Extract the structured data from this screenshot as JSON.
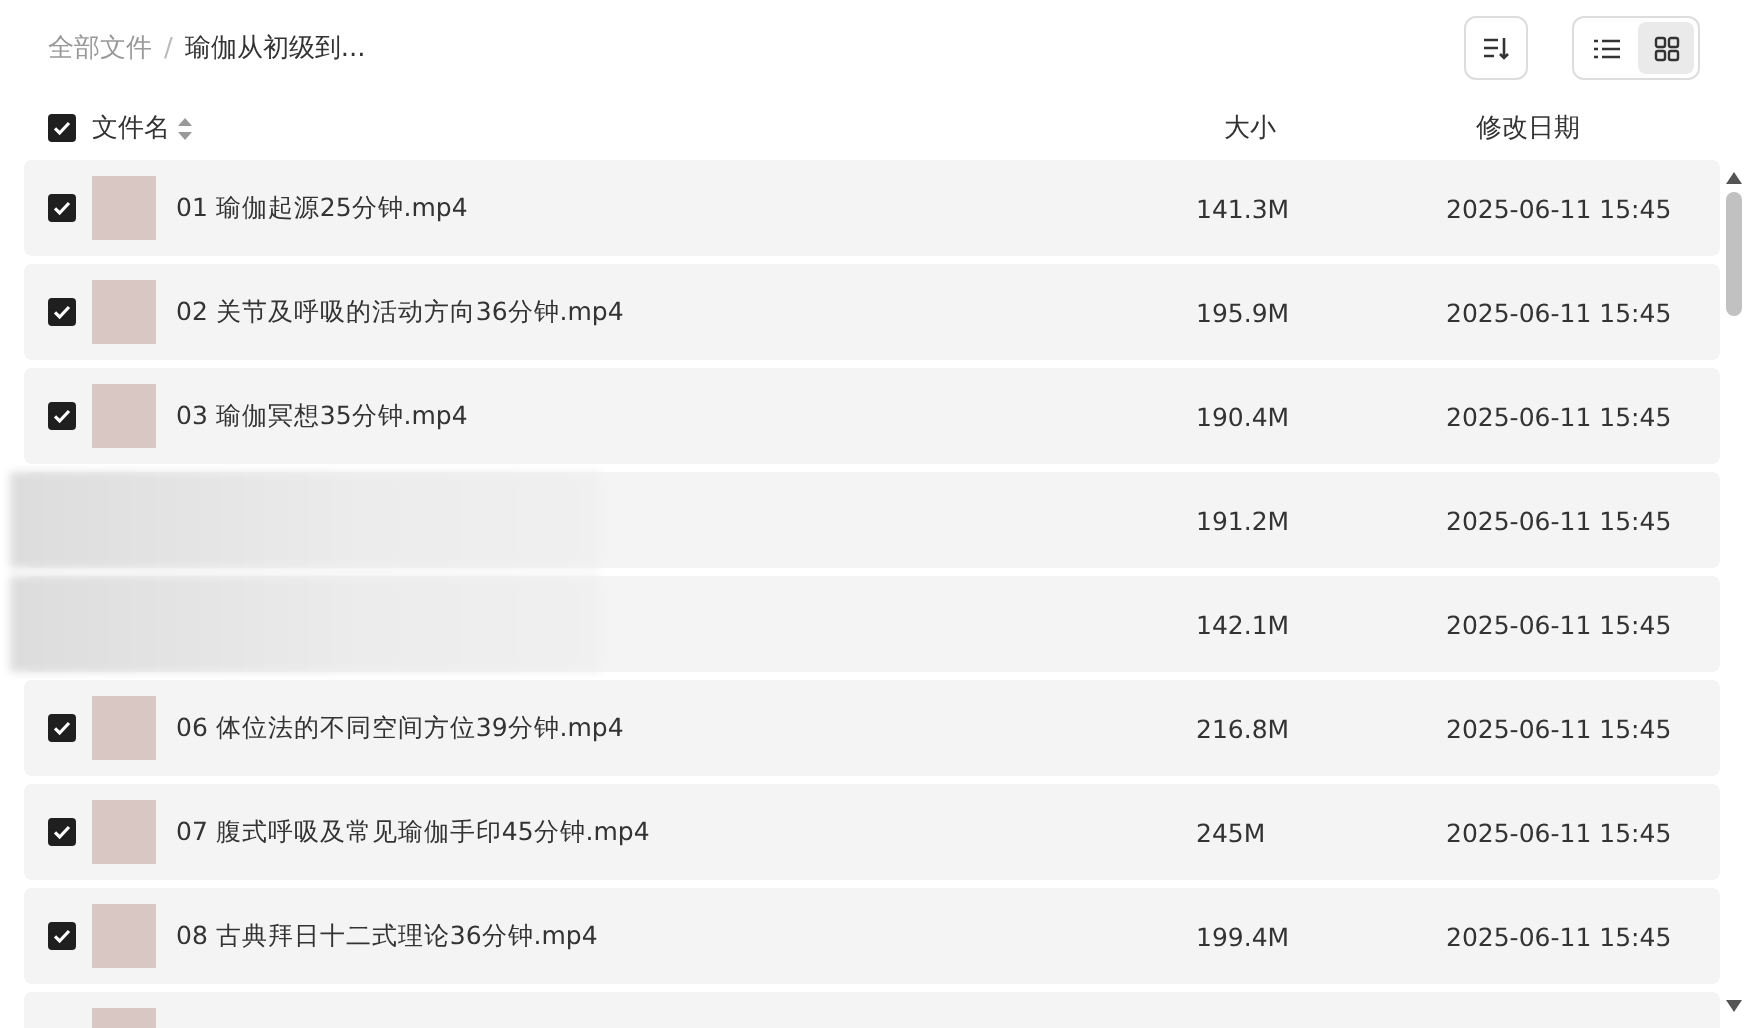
{
  "breadcrumb": [
    {
      "label": "全部文件",
      "current": false
    },
    {
      "label": "瑜伽从初级到...",
      "current": true
    }
  ],
  "breadcrumb_separator": "/",
  "view_toggle": [
    {
      "kind": "list",
      "selected": false
    },
    {
      "kind": "grid",
      "selected": true
    }
  ],
  "header": {
    "checked": true,
    "name": "文件名",
    "size": "大小",
    "date": "修改日期"
  },
  "rows": [
    {
      "kind": "file",
      "checked": true,
      "name": "01 瑜伽起源25分钟.mp4",
      "size": "141.3M",
      "date": "2025-06-11 15:45"
    },
    {
      "kind": "file",
      "checked": true,
      "name": "02 关节及呼吸的活动方向36分钟.mp4",
      "size": "195.9M",
      "date": "2025-06-11 15:45"
    },
    {
      "kind": "file",
      "checked": true,
      "name": "03 瑜伽冥想35分钟.mp4",
      "size": "190.4M",
      "date": "2025-06-11 15:45"
    },
    {
      "kind": "blurred",
      "size": "191.2M",
      "date": "2025-06-11 15:45"
    },
    {
      "kind": "blurred",
      "size": "142.1M",
      "date": "2025-06-11 15:45"
    },
    {
      "kind": "file",
      "checked": true,
      "name": "06 体位法的不同空间方位39分钟.mp4",
      "size": "216.8M",
      "date": "2025-06-11 15:45"
    },
    {
      "kind": "file",
      "checked": true,
      "name": "07 腹式呼吸及常见瑜伽手印45分钟.mp4",
      "size": "245M",
      "date": "2025-06-11 15:45"
    },
    {
      "kind": "file",
      "checked": true,
      "name": "08 古典拜日十二式理论36分钟.mp4",
      "size": "199.4M",
      "date": "2025-06-11 15:45"
    },
    {
      "kind": "file"
    }
  ]
}
